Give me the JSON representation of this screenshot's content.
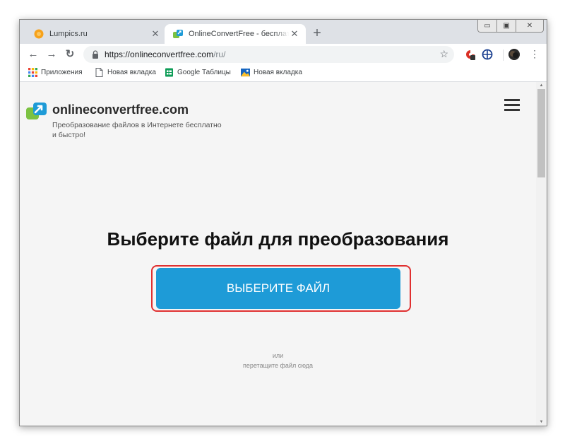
{
  "browser": {
    "tabs": [
      {
        "title": "Lumpics.ru",
        "active": false,
        "icon": "orange-circle-icon"
      },
      {
        "title": "OnlineConvertFree - бесплатный",
        "active": true,
        "icon": "onlineconvertfree-logo-icon"
      }
    ],
    "new_tab_label": "+",
    "window_controls": [
      "minimize",
      "maximize",
      "close"
    ],
    "url_scheme_host": "https://onlineconvertfree.com",
    "url_path": "/ru/"
  },
  "bookmarks": [
    {
      "label": "Приложения",
      "icon": "apps-grid-icon"
    },
    {
      "label": "Новая вкладка",
      "icon": "page-icon"
    },
    {
      "label": "Google Таблицы",
      "icon": "sheets-icon"
    },
    {
      "label": "Новая вкладка",
      "icon": "image-icon"
    }
  ],
  "page": {
    "brand": "onlineconvertfree.com",
    "tagline": "Преобразование файлов в Интернете бесплатно и быстро!",
    "headline": "Выберите файл для преобразования",
    "cta_label": "ВЫБЕРИТЕ ФАЙЛ",
    "or_label": "или",
    "drop_label": "перетащите файл сюда"
  },
  "colors": {
    "cta": "#1e9bd7",
    "highlight": "#e03030",
    "page_bg": "#f5f5f5",
    "logo_green": "#7cc242",
    "logo_blue": "#1e9bd7"
  }
}
